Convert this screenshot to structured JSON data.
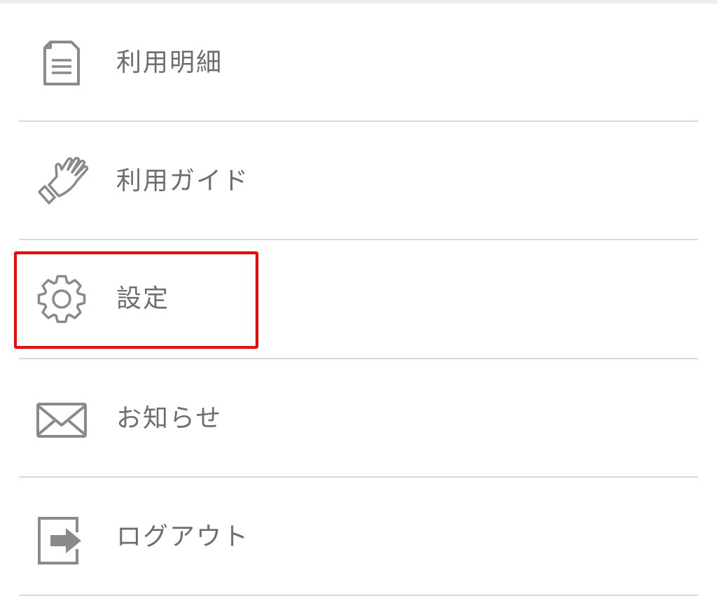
{
  "menu": {
    "items": [
      {
        "id": "statement",
        "label": "利用明細",
        "icon": "document-icon"
      },
      {
        "id": "guide",
        "label": "利用ガイド",
        "icon": "glove-icon"
      },
      {
        "id": "settings",
        "label": "設定",
        "icon": "gear-icon"
      },
      {
        "id": "notices",
        "label": "お知らせ",
        "icon": "envelope-icon"
      },
      {
        "id": "logout",
        "label": "ログアウト",
        "icon": "logout-icon"
      }
    ],
    "highlighted_item": "settings"
  },
  "colors": {
    "icon": "#8a8a8a",
    "label": "#6e6e6e",
    "divider": "#dadada",
    "highlight": "#ff0000"
  }
}
